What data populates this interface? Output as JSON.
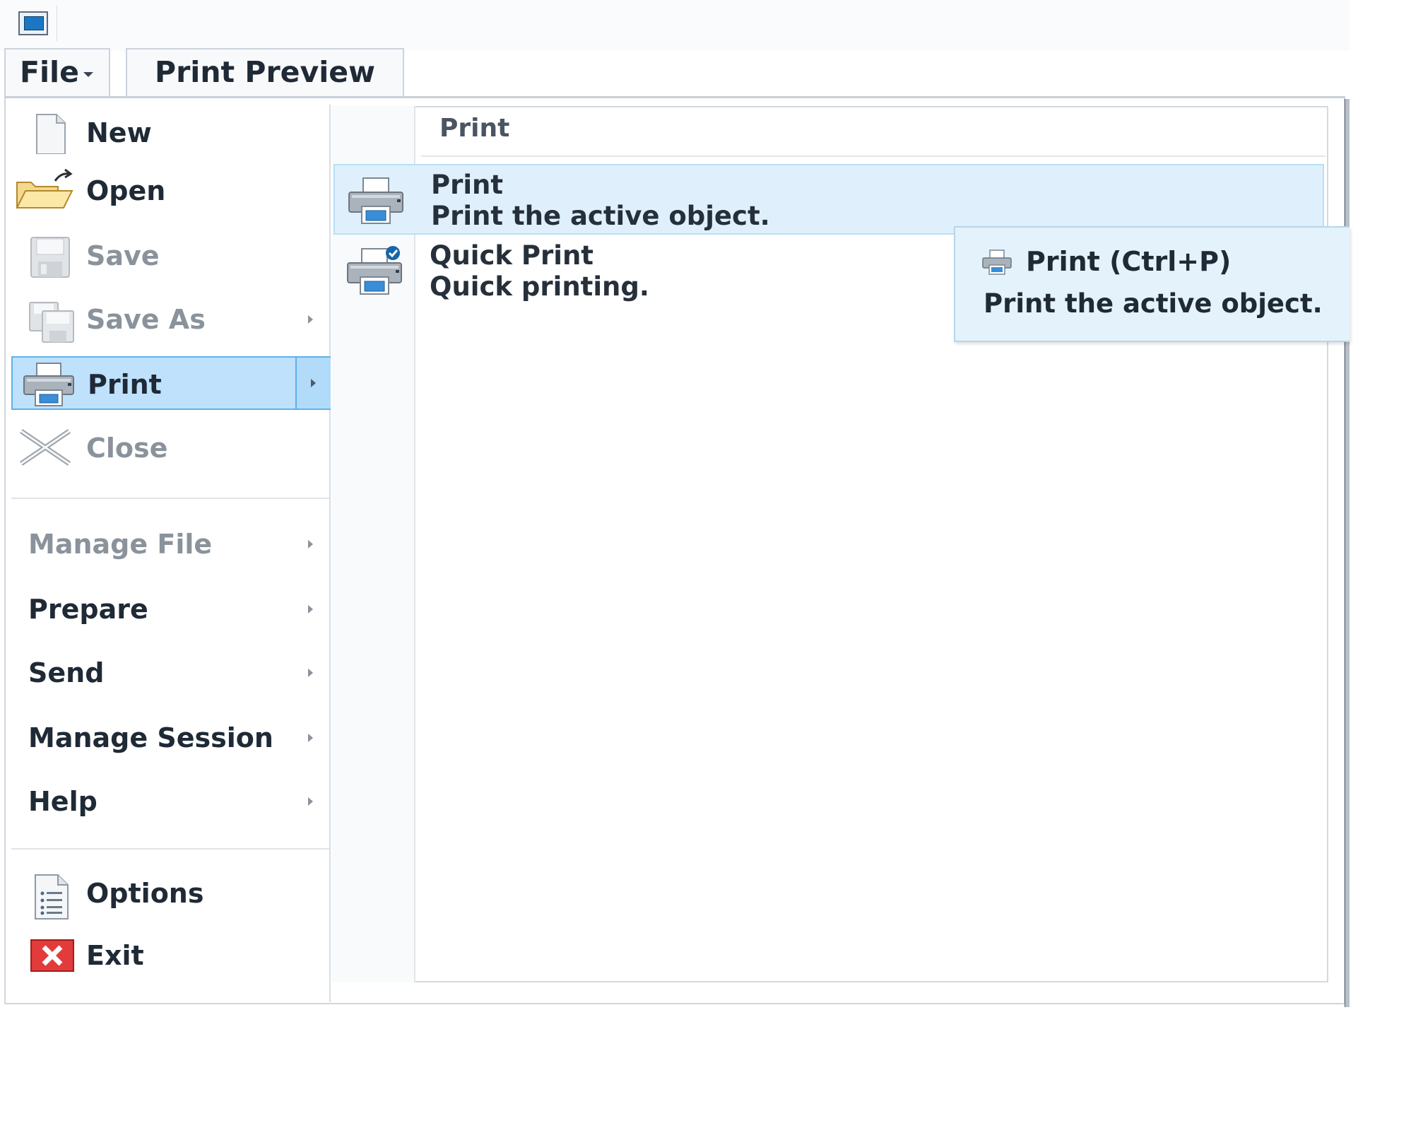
{
  "tabs": {
    "file": "File",
    "preview": "Print Preview"
  },
  "file_menu": {
    "items": [
      {
        "label": "New",
        "icon": "new-document-icon",
        "enabled": true
      },
      {
        "label": "Open",
        "icon": "open-folder-icon",
        "enabled": true
      },
      {
        "label": "Save",
        "icon": "save-disk-icon",
        "enabled": false
      },
      {
        "label": "Save As",
        "icon": "save-as-icon",
        "enabled": false,
        "submenu": true
      },
      {
        "label": "Print",
        "icon": "printer-icon",
        "enabled": true,
        "submenu": true,
        "active": true
      },
      {
        "label": "Close",
        "icon": "close-x-icon",
        "enabled": false
      }
    ],
    "groups": [
      {
        "label": "Manage File",
        "enabled": false,
        "submenu": true
      },
      {
        "label": "Prepare",
        "enabled": true,
        "submenu": true
      },
      {
        "label": "Send",
        "enabled": true,
        "submenu": true
      },
      {
        "label": "Manage Session",
        "enabled": true,
        "submenu": true
      },
      {
        "label": "Help",
        "enabled": true,
        "submenu": true
      }
    ],
    "footer": [
      {
        "label": "Options",
        "icon": "options-list-icon"
      },
      {
        "label": "Exit",
        "icon": "exit-red-x-icon"
      }
    ]
  },
  "print_submenu": {
    "header": "Print",
    "items": [
      {
        "title": "Print",
        "description": "Print the active object.",
        "icon": "printer-icon",
        "highlighted": true
      },
      {
        "title": "Quick Print",
        "description": "Quick printing.",
        "icon": "quick-print-icon",
        "highlighted": false
      }
    ]
  },
  "tooltip": {
    "title": "Print  (Ctrl+P)",
    "description": "Print the active object.",
    "icon": "printer-small-icon"
  },
  "colors": {
    "active_bg": "#bfe1fb",
    "active_border": "#5cb2ea",
    "hover_bg": "#dff0fc",
    "tooltip_bg": "#e4f2fc",
    "exit_red": "#e23b3b"
  }
}
